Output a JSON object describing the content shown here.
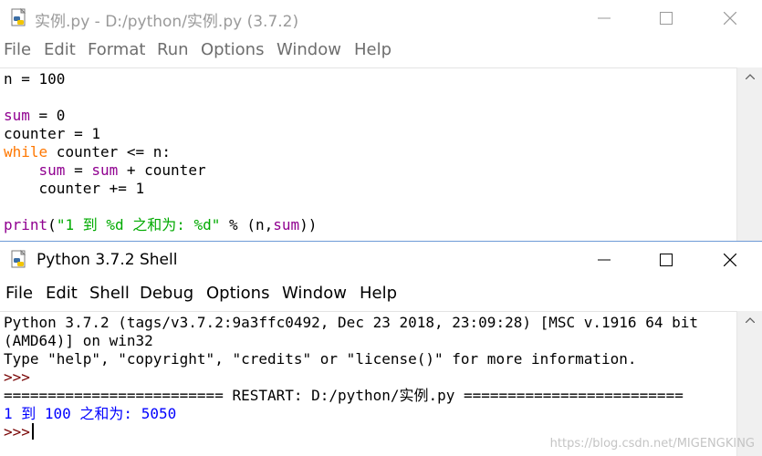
{
  "editor": {
    "title": "实例.py - D:/python/实例.py (3.7.2)",
    "menu": [
      "File",
      "Edit",
      "Format",
      "Run",
      "Options",
      "Window",
      "Help"
    ],
    "code": {
      "line1_var": "n",
      "line1_rest": " = 100",
      "line3_var": "sum",
      "line3_rest": " = 0",
      "line4": "counter = 1",
      "line5_kw": "while",
      "line5_rest": " counter <= n:",
      "line6_indent": "    ",
      "line6_var1": "sum",
      "line6_mid": " = ",
      "line6_var2": "sum",
      "line6_rest": " + counter",
      "line7": "    counter += 1",
      "line9_fn": "print",
      "line9_open": "(",
      "line9_str": "\"1 到 %d 之和为: %d\"",
      "line9_mid": " % (n,",
      "line9_sum": "sum",
      "line9_close": "))"
    }
  },
  "shell": {
    "title": "Python 3.7.2 Shell",
    "menu": [
      "File",
      "Edit",
      "Shell",
      "Debug",
      "Options",
      "Window",
      "Help"
    ],
    "lines": {
      "banner1": "Python 3.7.2 (tags/v3.7.2:9a3ffc0492, Dec 23 2018, 23:09:28) [MSC v.1916 64 bit",
      "banner2": "(AMD64)] on win32",
      "banner3": "Type \"help\", \"copyright\", \"credits\" or \"license()\" for more information.",
      "prompt1": ">>>",
      "restart": "========================= RESTART: D:/python/实例.py =========================",
      "output": "1 到 100 之和为: 5050",
      "prompt2": ">>>"
    }
  },
  "watermark": "https://blog.csdn.net/MIGENGKING",
  "colors": {
    "keyword": "#ff7700",
    "builtin": "#900090",
    "string": "#00aa00",
    "prompt": "#770000",
    "output": "#0000ff"
  }
}
